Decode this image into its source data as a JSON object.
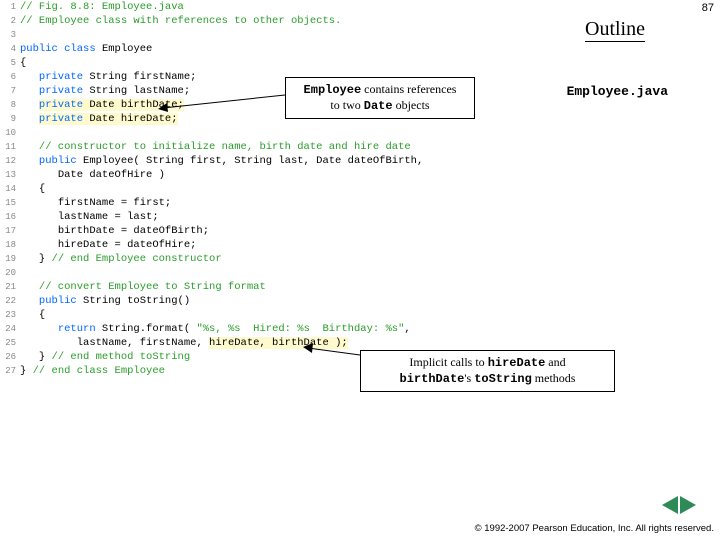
{
  "page_number": "87",
  "outline": "Outline",
  "filename": "Employee.java",
  "callout1": {
    "p1a": "Employee",
    "p1b": " contains references",
    "p2a": "to two ",
    "p2b": "Date",
    "p2c": " objects"
  },
  "callout2": {
    "p1a": "Implicit calls to ",
    "p1b": "hireDate",
    "p1c": " and",
    "p2a": "birthDate",
    "p2b": "'s ",
    "p2c": "toString",
    "p2d": " methods"
  },
  "copyright": "© 1992-2007 Pearson Education, Inc.  All rights reserved.",
  "code": {
    "l1": {
      "n": "1",
      "c": "// Fig. 8.8: Employee.java"
    },
    "l2": {
      "n": "2",
      "c": "// Employee class with references to other objects."
    },
    "l3": {
      "n": "3"
    },
    "l4": {
      "n": "4",
      "k1": "public",
      "k2": "class",
      "t": " Employee"
    },
    "l5": {
      "n": "5",
      "t": "{"
    },
    "l6": {
      "n": "6",
      "k": "private",
      "t": " String firstName;"
    },
    "l7": {
      "n": "7",
      "k": "private",
      "t": " String lastName;"
    },
    "l8": {
      "n": "8",
      "k": "private",
      "t": " Date birthDate;"
    },
    "l9": {
      "n": "9",
      "k": "private",
      "t": " Date hireDate;"
    },
    "l10": {
      "n": "10"
    },
    "l11": {
      "n": "11",
      "c": "// constructor to initialize name, birth date and hire date"
    },
    "l12": {
      "n": "12",
      "k": "public",
      "t": " Employee( String first, String last, Date dateOfBirth,"
    },
    "l13": {
      "n": "13",
      "t": "Date dateOfHire )"
    },
    "l14": {
      "n": "14",
      "t": "{"
    },
    "l15": {
      "n": "15",
      "t": "firstName = first;"
    },
    "l16": {
      "n": "16",
      "t": "lastName = last;"
    },
    "l17": {
      "n": "17",
      "t": "birthDate = dateOfBirth;"
    },
    "l18": {
      "n": "18",
      "t": "hireDate = dateOfHire;"
    },
    "l19": {
      "n": "19",
      "t": "} ",
      "c": "// end Employee constructor"
    },
    "l20": {
      "n": "20"
    },
    "l21": {
      "n": "21",
      "c": "// convert Employee to String format"
    },
    "l22": {
      "n": "22",
      "k": "public",
      "t": " String toString()"
    },
    "l23": {
      "n": "23",
      "t": "{"
    },
    "l24": {
      "n": "24",
      "k": "return",
      "t1": " String.format( ",
      "s": "\"%s, %s  Hired: %s  Birthday: %s\"",
      "t2": ","
    },
    "l25": {
      "n": "25",
      "t": "lastName, firstName, ",
      "h": "hireDate, birthDate );"
    },
    "l26": {
      "n": "26",
      "t": "} ",
      "c": "// end method toString"
    },
    "l27": {
      "n": "27",
      "t": "} ",
      "c": "// end class Employee"
    }
  }
}
